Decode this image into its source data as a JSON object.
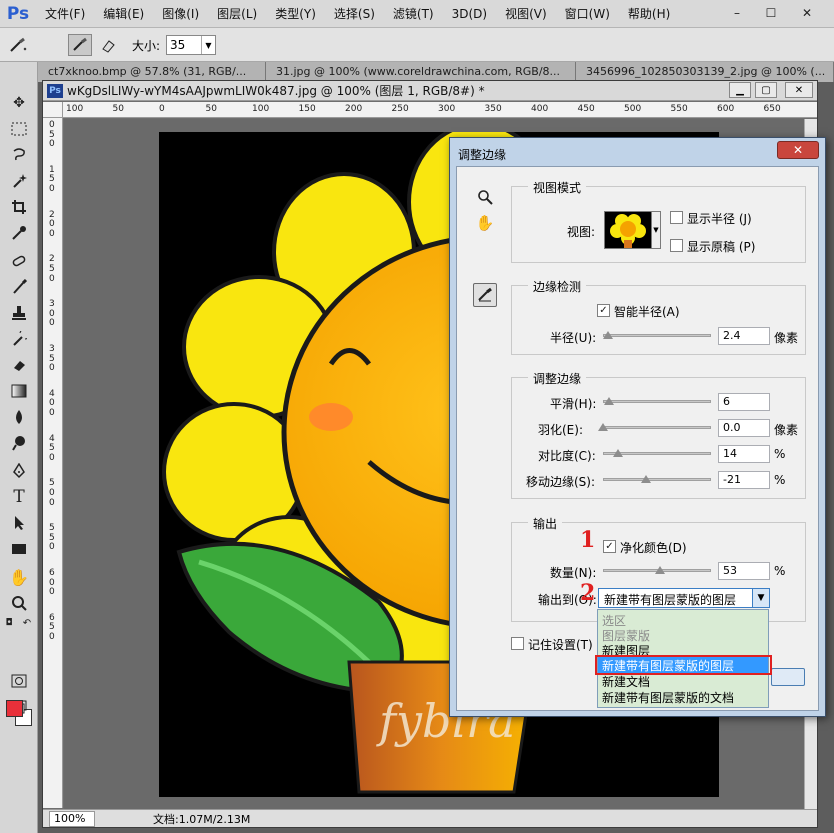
{
  "menubar": {
    "logo": "Ps",
    "items": [
      "文件(F)",
      "编辑(E)",
      "图像(I)",
      "图层(L)",
      "类型(Y)",
      "选择(S)",
      "滤镜(T)",
      "3D(D)",
      "视图(V)",
      "窗口(W)",
      "帮助(H)"
    ],
    "window_controls": [
      "–",
      "☐",
      "✕"
    ]
  },
  "options": {
    "size_label": "大小:",
    "size_value": "35"
  },
  "tabs": [
    "ct7xknoo.bmp @ 57.8% (31, RGB/...",
    "31.jpg @ 100% (www.coreldrawchina.com, RGB/8...",
    "3456996_102850303139_2.jpg @ 100% (..."
  ],
  "document": {
    "title": "wKgDslLIWy-wYM4sAAJpwmLIW0k487.jpg @ 100% (图层 1, RGB/8#) *",
    "ruler_h": [
      "100",
      "50",
      "0",
      "50",
      "100",
      "150",
      "200",
      "250",
      "300",
      "350",
      "400",
      "450",
      "500",
      "550",
      "600",
      "650"
    ],
    "ruler_v": [
      "0",
      "5",
      "0",
      "1",
      "5",
      "0",
      "2",
      "0",
      "0",
      "2",
      "5",
      "0",
      "3",
      "0",
      "0",
      "3",
      "5",
      "0",
      "4",
      "0",
      "0",
      "4",
      "5",
      "0",
      "5",
      "0",
      "0",
      "5",
      "5",
      "0",
      "6",
      "0",
      "0",
      "6",
      "5",
      "0"
    ],
    "zoom": "100%",
    "info": "文档:1.07M/2.13M",
    "watermark": "fybira"
  },
  "dialog": {
    "title": "调整边缘",
    "close": "✕",
    "view_mode": {
      "title": "视图模式",
      "view_label": "视图:",
      "show_radius": "显示半径 (J)",
      "show_original": "显示原稿 (P)"
    },
    "edge_detection": {
      "title": "边缘检测",
      "smart_radius": "智能半径(A)",
      "radius_label": "半径(U):",
      "radius_value": "2.4",
      "radius_unit": "像素",
      "radius_level": 0.05
    },
    "adjust_edge": {
      "title": "调整边缘",
      "smooth_label": "平滑(H):",
      "smooth_value": "6",
      "smooth_level": 0.06,
      "feather_label": "羽化(E):",
      "feather_value": "0.0",
      "feather_unit": "像素",
      "feather_level": 0.0,
      "contrast_label": "对比度(C):",
      "contrast_value": "14",
      "contrast_unit": "%",
      "contrast_level": 0.14,
      "shift_label": "移动边缘(S):",
      "shift_value": "-21",
      "shift_unit": "%",
      "shift_level": 0.395
    },
    "output": {
      "title": "输出",
      "decontaminate": "净化颜色(D)",
      "amount_label": "数量(N):",
      "amount_value": "53",
      "amount_unit": "%",
      "amount_level": 0.53,
      "output_to_label": "输出到(O):",
      "output_to_value": "新建带有图层蒙版的图层",
      "options": [
        "选区",
        "图层蒙版",
        "新建图层",
        "新建带有图层蒙版的图层",
        "新建文档",
        "新建带有图层蒙版的文档"
      ]
    },
    "remember": "记住设置(T)"
  },
  "annotations": {
    "step1": "1",
    "step2": "2"
  }
}
